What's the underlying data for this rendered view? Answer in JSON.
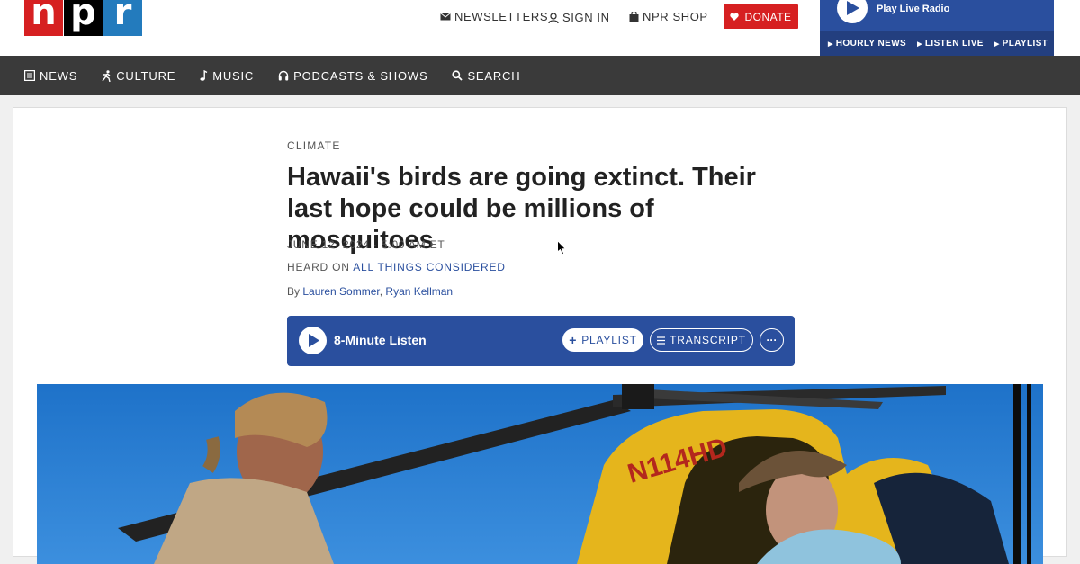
{
  "logo": {
    "letters": [
      "n",
      "p",
      "r"
    ]
  },
  "utility": {
    "newsletters": "NEWSLETTERS",
    "sign_in": "SIGN IN",
    "shop": "NPR SHOP",
    "donate": "DONATE"
  },
  "radio": {
    "title": "Play Live Radio",
    "links": [
      "HOURLY NEWS",
      "LISTEN LIVE",
      "PLAYLIST"
    ]
  },
  "nav": [
    {
      "label": "NEWS",
      "icon": "news-icon"
    },
    {
      "label": "CULTURE",
      "icon": "culture-icon"
    },
    {
      "label": "MUSIC",
      "icon": "music-icon"
    },
    {
      "label": "PODCASTS & SHOWS",
      "icon": "headphones-icon"
    },
    {
      "label": "SEARCH",
      "icon": "search-icon"
    }
  ],
  "article": {
    "slug": "CLIMATE",
    "headline": "Hawaii's birds are going extinct. Their last hope could be millions of mosquitoes",
    "date": "JUNE 12, 2024 · 5:00 AM ET",
    "heard_on_prefix": "HEARD ON ",
    "heard_on_show": "ALL THINGS CONSIDERED",
    "byline_prefix": "By ",
    "author1": "Lauren Sommer",
    "separator": ", ",
    "author2": "Ryan Kellman"
  },
  "player": {
    "label": "8-Minute Listen",
    "playlist": "PLAYLIST",
    "transcript": "TRANSCRIPT",
    "more": "···"
  },
  "photo": {
    "tail_number": "N114HD"
  },
  "colors": {
    "npr_red": "#d62021",
    "npr_blue": "#237bbd",
    "player_blue": "#2a4f9e",
    "nav_dark": "#3a3a3a"
  }
}
